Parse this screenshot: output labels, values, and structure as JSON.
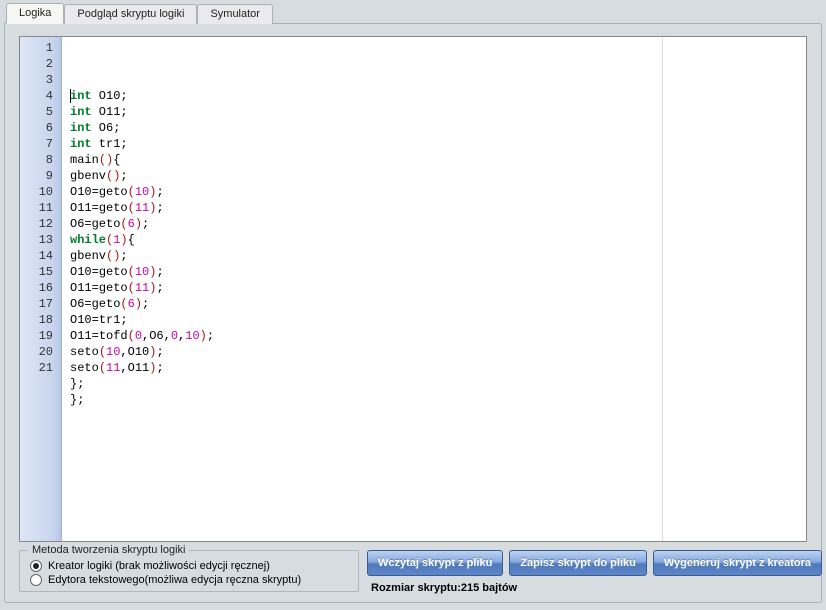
{
  "tabs": {
    "logika": "Logika",
    "podglad": "Podgląd skryptu logiki",
    "symulator": "Symulator"
  },
  "code": {
    "lines": [
      [
        [
          "kw",
          "int"
        ],
        [
          "punct",
          " O10"
        ],
        [
          "punct",
          ";"
        ]
      ],
      [
        [
          "kw",
          "int"
        ],
        [
          "punct",
          " O11"
        ],
        [
          "punct",
          ";"
        ]
      ],
      [
        [
          "kw",
          "int"
        ],
        [
          "punct",
          " O6"
        ],
        [
          "punct",
          ";"
        ]
      ],
      [
        [
          "kw",
          "int"
        ],
        [
          "punct",
          " tr1"
        ],
        [
          "punct",
          ";"
        ]
      ],
      [
        [
          "fn",
          "main"
        ],
        [
          "paren",
          "()"
        ],
        [
          "punct",
          "{"
        ]
      ],
      [
        [
          "fn",
          "gbenv"
        ],
        [
          "paren",
          "()"
        ],
        [
          "punct",
          ";"
        ]
      ],
      [
        [
          "punct",
          "O10"
        ],
        [
          "punct",
          "="
        ],
        [
          "fn",
          "geto"
        ],
        [
          "paren",
          "("
        ],
        [
          "num",
          "10"
        ],
        [
          "paren",
          ")"
        ],
        [
          "punct",
          ";"
        ]
      ],
      [
        [
          "punct",
          "O11"
        ],
        [
          "punct",
          "="
        ],
        [
          "fn",
          "geto"
        ],
        [
          "paren",
          "("
        ],
        [
          "num",
          "11"
        ],
        [
          "paren",
          ")"
        ],
        [
          "punct",
          ";"
        ]
      ],
      [
        [
          "punct",
          "O6"
        ],
        [
          "punct",
          "="
        ],
        [
          "fn",
          "geto"
        ],
        [
          "paren",
          "("
        ],
        [
          "num",
          "6"
        ],
        [
          "paren",
          ")"
        ],
        [
          "punct",
          ";"
        ]
      ],
      [
        [
          "kw",
          "while"
        ],
        [
          "paren",
          "("
        ],
        [
          "num",
          "1"
        ],
        [
          "paren",
          ")"
        ],
        [
          "punct",
          "{"
        ]
      ],
      [
        [
          "fn",
          "gbenv"
        ],
        [
          "paren",
          "()"
        ],
        [
          "punct",
          ";"
        ]
      ],
      [
        [
          "punct",
          "O10"
        ],
        [
          "punct",
          "="
        ],
        [
          "fn",
          "geto"
        ],
        [
          "paren",
          "("
        ],
        [
          "num",
          "10"
        ],
        [
          "paren",
          ")"
        ],
        [
          "punct",
          ";"
        ]
      ],
      [
        [
          "punct",
          "O11"
        ],
        [
          "punct",
          "="
        ],
        [
          "fn",
          "geto"
        ],
        [
          "paren",
          "("
        ],
        [
          "num",
          "11"
        ],
        [
          "paren",
          ")"
        ],
        [
          "punct",
          ";"
        ]
      ],
      [
        [
          "punct",
          "O6"
        ],
        [
          "punct",
          "="
        ],
        [
          "fn",
          "geto"
        ],
        [
          "paren",
          "("
        ],
        [
          "num",
          "6"
        ],
        [
          "paren",
          ")"
        ],
        [
          "punct",
          ";"
        ]
      ],
      [
        [
          "punct",
          "O10"
        ],
        [
          "punct",
          "="
        ],
        [
          "punct",
          "tr1"
        ],
        [
          "punct",
          ";"
        ]
      ],
      [
        [
          "punct",
          "O11"
        ],
        [
          "punct",
          "="
        ],
        [
          "fn",
          "tofd"
        ],
        [
          "paren",
          "("
        ],
        [
          "num",
          "0"
        ],
        [
          "punct",
          ","
        ],
        [
          "punct",
          "O6"
        ],
        [
          "punct",
          ","
        ],
        [
          "num",
          "0"
        ],
        [
          "punct",
          ","
        ],
        [
          "num",
          "10"
        ],
        [
          "paren",
          ")"
        ],
        [
          "punct",
          ";"
        ]
      ],
      [
        [
          "fn",
          "seto"
        ],
        [
          "paren",
          "("
        ],
        [
          "num",
          "10"
        ],
        [
          "punct",
          ","
        ],
        [
          "punct",
          "O10"
        ],
        [
          "paren",
          ")"
        ],
        [
          "punct",
          ";"
        ]
      ],
      [
        [
          "fn",
          "seto"
        ],
        [
          "paren",
          "("
        ],
        [
          "num",
          "11"
        ],
        [
          "punct",
          ","
        ],
        [
          "punct",
          "O11"
        ],
        [
          "paren",
          ")"
        ],
        [
          "punct",
          ";"
        ]
      ],
      [
        [
          "punct",
          "}"
        ],
        [
          "punct",
          ";"
        ]
      ],
      [
        [
          "punct",
          "}"
        ],
        [
          "punct",
          ";"
        ]
      ],
      []
    ],
    "line_count": 21
  },
  "group": {
    "title": "Metoda tworzenia skryptu logiki",
    "opt1": "Kreator logiki (brak możliwości edycji ręcznej)",
    "opt2": "Edytora tekstowego(możliwa edycja ręczna skryptu)"
  },
  "buttons": {
    "load": "Wczytaj skrypt z pliku",
    "save": "Zapisz skrypt do pliku",
    "generate": "Wygeneruj skrypt z kreatora"
  },
  "status": {
    "label": "Rozmiar skryptu:",
    "value": "215 bajtów"
  }
}
